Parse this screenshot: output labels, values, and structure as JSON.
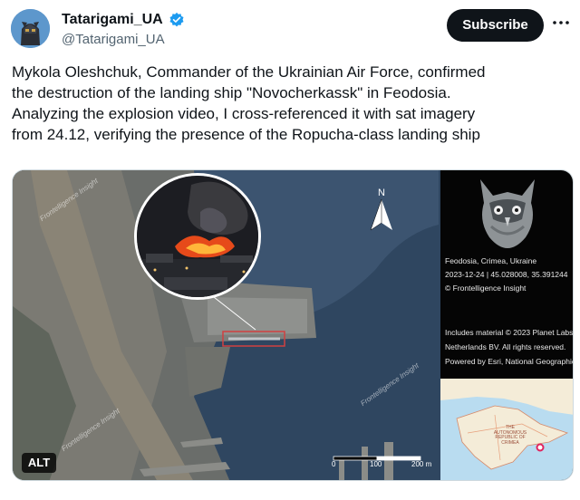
{
  "account": {
    "display_name": "Tatarigami_UA",
    "handle": "@Tatarigami_UA",
    "verified": true
  },
  "actions": {
    "subscribe_label": "Subscribe",
    "more_icon": "more-horizontal-icon"
  },
  "tweet": {
    "text": "Mykola Oleshchuk, Commander of the Ukrainian Air Force, confirmed\nthe destruction of the landing ship \"Novocherkassk\" in Feodosia.\nAnalyzing the explosion video, I cross-referenced it with sat imagery\nfrom 24.12, verifying the presence of the Ropucha-class landing ship"
  },
  "media": {
    "alt_label": "ALT",
    "north_label": "N",
    "scale_labels": [
      "0",
      "100",
      "200 m"
    ],
    "watermark": "Frontelligence Insight",
    "side_panel": {
      "location": "Feodosia, Crimea, Ukraine",
      "date_coords": "2023-12-24 | 45.028008, 35.391244",
      "credit": "© Frontelligence Insight",
      "attribution_1": "Includes material © 2023 Planet Labs",
      "attribution_2": "Netherlands BV. All rights reserved.",
      "attribution_3": "Powered by Esri, National Geographic"
    },
    "inset_map_label": "THE AUTONOMOUS REPUBLIC OF CRIMEA"
  },
  "colors": {
    "subscribe_bg": "#0f1419",
    "verified": "#1d9bf0",
    "marker": "#e0245e"
  }
}
